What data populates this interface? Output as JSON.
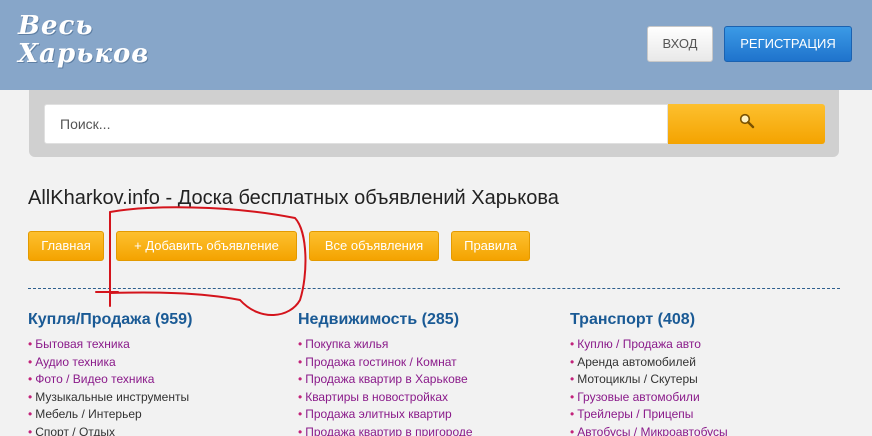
{
  "header": {
    "logo_line1": "Весь",
    "logo_line2": "Харьков",
    "login_label": "ВХОД",
    "register_label": "РЕГИСТРАЦИЯ"
  },
  "search": {
    "placeholder": "Поиск...",
    "button_icon": "search-icon"
  },
  "page_title": "AllKharkov.info - Доска бесплатных объявлений Харькова",
  "nav": [
    {
      "label": "Главная"
    },
    {
      "label": "+ Добавить объявление"
    },
    {
      "label": "Все объявления"
    },
    {
      "label": "Правила"
    }
  ],
  "categories": [
    {
      "title": "Купля/Продажа (959)",
      "items": [
        "Бытовая техника",
        "Аудио техника",
        "Фото / Видео техника",
        "Музыкальные инструменты",
        "Мебель / Интерьер",
        "Спорт / Отдых"
      ]
    },
    {
      "title": "Недвижимость (285)",
      "items": [
        "Покупка жилья",
        "Продажа гостинок / Комнат",
        "Продажа квартир в Харькове",
        "Квартиры в новостройках",
        "Продажа элитных квартир",
        "Продажа квартир в пригороде"
      ]
    },
    {
      "title": "Транспорт (408)",
      "items": [
        "Куплю / Продажа авто",
        "Аренда автомобилей",
        "Мотоциклы / Скутеры",
        "Грузовые автомобили",
        "Трейлеры / Прицепы",
        "Автобусы / Микроавтобусы"
      ]
    }
  ],
  "colors": {
    "header_bg": "#87a6c9",
    "accent_orange": "#f4a300",
    "register_blue": "#1f73cc",
    "category_title": "#1a5a95",
    "annotation_red": "#d4141c"
  }
}
